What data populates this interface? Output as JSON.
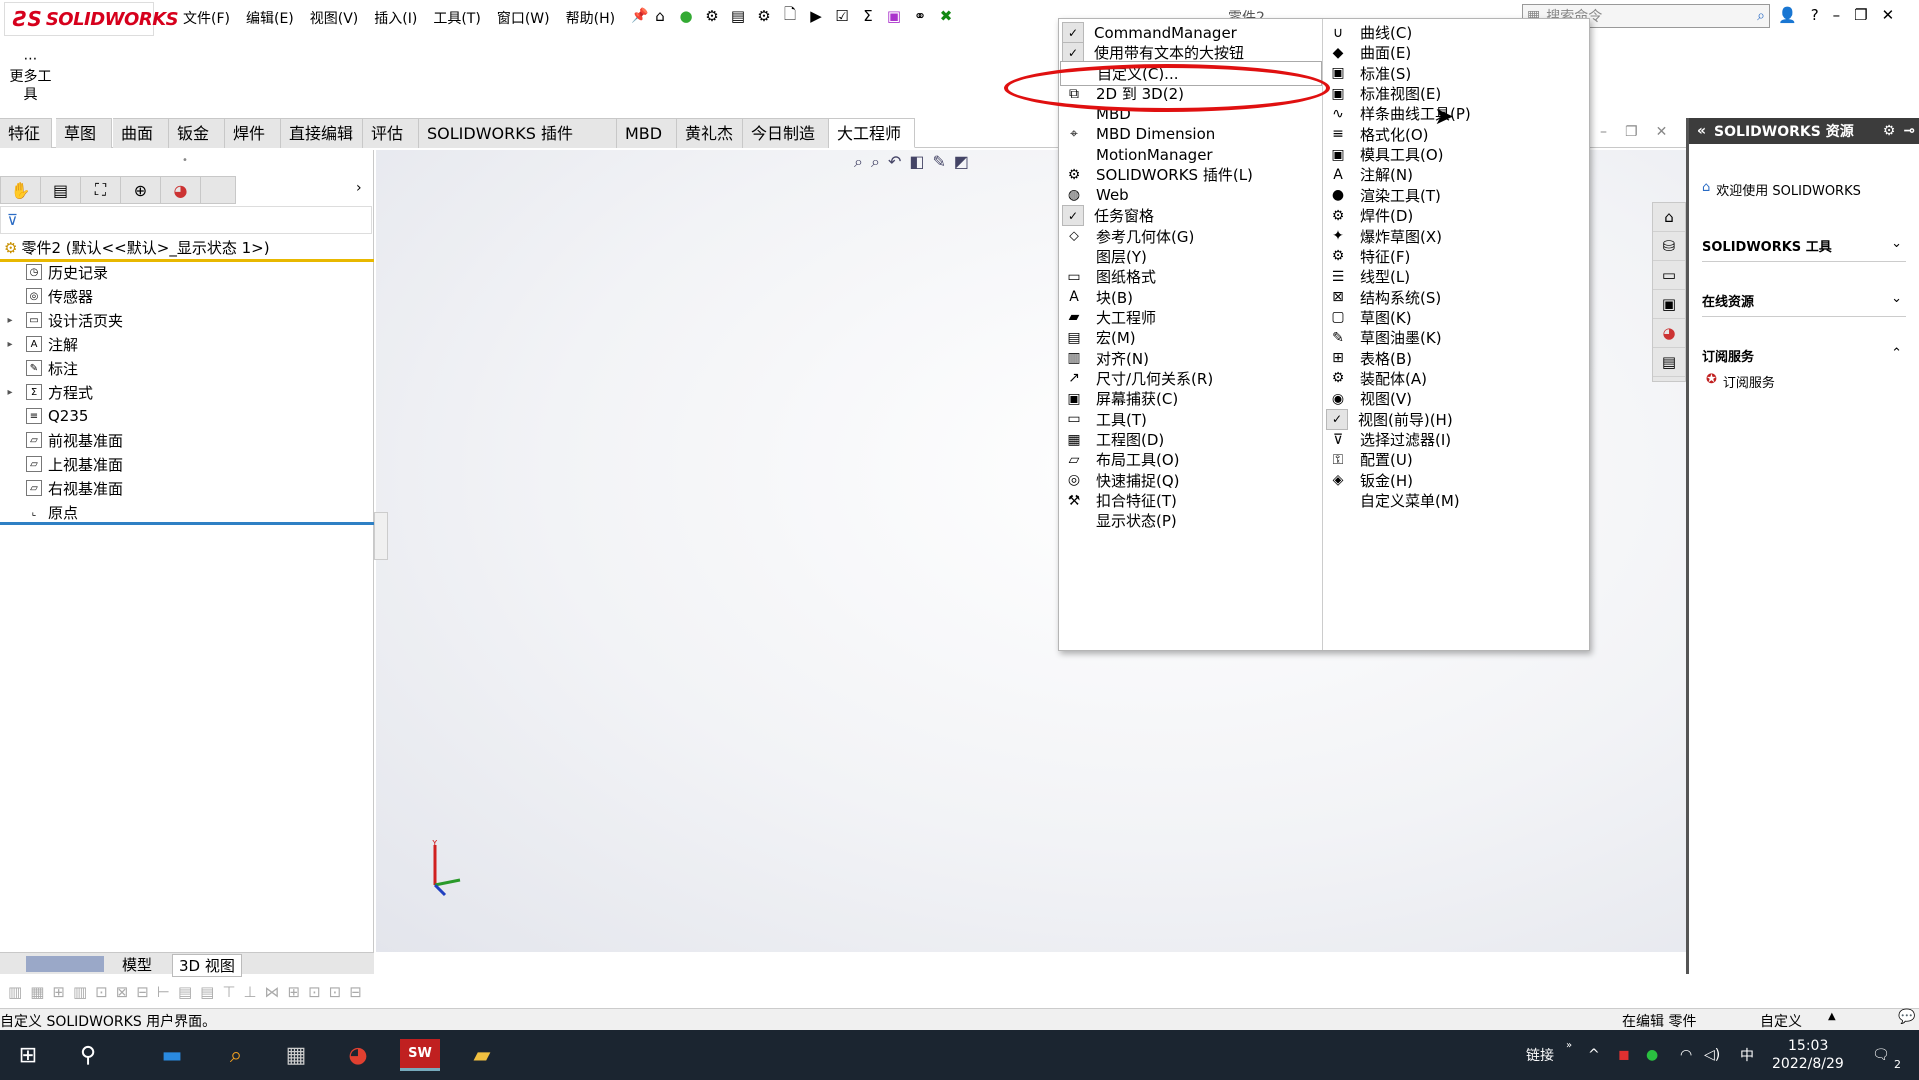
{
  "app": {
    "name": "SOLIDWORKS",
    "doc_title": "零件2"
  },
  "menus": [
    "文件(F)",
    "编辑(E)",
    "视图(V)",
    "插入(I)",
    "工具(T)",
    "窗口(W)",
    "帮助(H)"
  ],
  "search": {
    "placeholder": "搜索命令"
  },
  "more_tools": "更多工具",
  "tabs": [
    "特征",
    "草图",
    "曲面",
    "钣金",
    "焊件",
    "直接编辑",
    "评估",
    "SOLIDWORKS 插件",
    "MBD",
    "黄礼杰",
    "今日制造",
    "大工程师"
  ],
  "tree": {
    "root": "零件2 (默认<<默认>_显示状态 1>)",
    "items": [
      "历史记录",
      "传感器",
      "设计活页夹",
      "注解",
      "标注",
      "方程式",
      "Q235",
      "前视基准面",
      "上视基准面",
      "右视基准面",
      "原点"
    ]
  },
  "bottom_tabs": [
    "模型",
    "3D 视图"
  ],
  "status": {
    "left": "自定义 SOLIDWORKS 用户界面。",
    "editing": "在编辑 零件",
    "custom": "自定义"
  },
  "taskbar": {
    "link": "链接",
    "ime": "中",
    "time": "15:03",
    "date": "2022/8/29",
    "notif": "2"
  },
  "right_panel": {
    "title": "SOLIDWORKS 资源",
    "welcome": "欢迎使用 SOLIDWORKS",
    "sections": [
      "SOLIDWORKS 工具",
      "在线资源",
      "订阅服务"
    ],
    "sub_item": "订阅服务"
  },
  "context_menu": {
    "col1": [
      {
        "label": "CommandManager",
        "icon": "check-icon",
        "checked": true
      },
      {
        "label": "使用带有文本的大按钮",
        "icon": "check-icon",
        "checked": true
      },
      {
        "label": "自定义(C)...",
        "icon": "none",
        "checked": false
      },
      {
        "label": "2D 到 3D(2)",
        "icon": "2d-to-3d-icon",
        "checked": false
      },
      {
        "label": "MBD",
        "icon": "none",
        "checked": false
      },
      {
        "label": "MBD Dimension",
        "icon": "mbd-dimension-icon",
        "checked": false
      },
      {
        "label": "MotionManager",
        "icon": "none",
        "checked": false
      },
      {
        "label": "SOLIDWORKS 插件(L)",
        "icon": "addins-icon",
        "checked": false
      },
      {
        "label": "Web",
        "icon": "web-icon",
        "checked": false
      },
      {
        "label": "任务窗格",
        "icon": "check-icon",
        "checked": true
      },
      {
        "label": "参考几何体(G)",
        "icon": "reference-geometry-icon",
        "checked": false
      },
      {
        "label": "图层(Y)",
        "icon": "none",
        "checked": false
      },
      {
        "label": "图纸格式",
        "icon": "sheet-format-icon",
        "checked": false
      },
      {
        "label": "块(B)",
        "icon": "block-icon",
        "checked": false
      },
      {
        "label": "大工程师",
        "icon": "folder-icon",
        "checked": false
      },
      {
        "label": "宏(M)",
        "icon": "macro-icon",
        "checked": false
      },
      {
        "label": "对齐(N)",
        "icon": "align-icon",
        "checked": false
      },
      {
        "label": "尺寸/几何关系(R)",
        "icon": "dimension-icon",
        "checked": false
      },
      {
        "label": "屏幕捕获(C)",
        "icon": "screen-capture-icon",
        "checked": false
      },
      {
        "label": "工具(T)",
        "icon": "tools-icon",
        "checked": false
      },
      {
        "label": "工程图(D)",
        "icon": "drawing-icon",
        "checked": false
      },
      {
        "label": "布局工具(O)",
        "icon": "layout-icon",
        "checked": false
      },
      {
        "label": "快速捕捉(Q)",
        "icon": "quick-snap-icon",
        "checked": false
      },
      {
        "label": "扣合特征(T)",
        "icon": "fastening-icon",
        "checked": false
      },
      {
        "label": "显示状态(P)",
        "icon": "none",
        "checked": false
      }
    ],
    "col2": [
      {
        "label": "曲线(C)",
        "icon": "curve-icon"
      },
      {
        "label": "曲面(E)",
        "icon": "surface-icon"
      },
      {
        "label": "标准(S)",
        "icon": "standard-icon"
      },
      {
        "label": "标准视图(E)",
        "icon": "standard-view-icon"
      },
      {
        "label": "样条曲线工具(P)",
        "icon": "spline-icon"
      },
      {
        "label": "格式化(O)",
        "icon": "format-icon"
      },
      {
        "label": "模具工具(O)",
        "icon": "mold-icon"
      },
      {
        "label": "注解(N)",
        "icon": "annotation-icon"
      },
      {
        "label": "渲染工具(T)",
        "icon": "render-icon"
      },
      {
        "label": "焊件(D)",
        "icon": "weldment-icon"
      },
      {
        "label": "爆炸草图(X)",
        "icon": "explode-sketch-icon"
      },
      {
        "label": "特征(F)",
        "icon": "features-icon"
      },
      {
        "label": "线型(L)",
        "icon": "line-format-icon"
      },
      {
        "label": "结构系统(S)",
        "icon": "structure-icon"
      },
      {
        "label": "草图(K)",
        "icon": "sketch-icon"
      },
      {
        "label": "草图油墨(K)",
        "icon": "sketch-ink-icon"
      },
      {
        "label": "表格(B)",
        "icon": "table-icon"
      },
      {
        "label": "装配体(A)",
        "icon": "assembly-icon"
      },
      {
        "label": "视图(V)",
        "icon": "view-icon"
      },
      {
        "label": "视图(前导)(H)",
        "icon": "check-icon"
      },
      {
        "label": "选择过滤器(I)",
        "icon": "filter-icon"
      },
      {
        "label": "配置(U)",
        "icon": "configuration-icon"
      },
      {
        "label": "钣金(H)",
        "icon": "sheet-metal-icon"
      },
      {
        "label": "自定义菜单(M)",
        "icon": "none"
      }
    ]
  }
}
